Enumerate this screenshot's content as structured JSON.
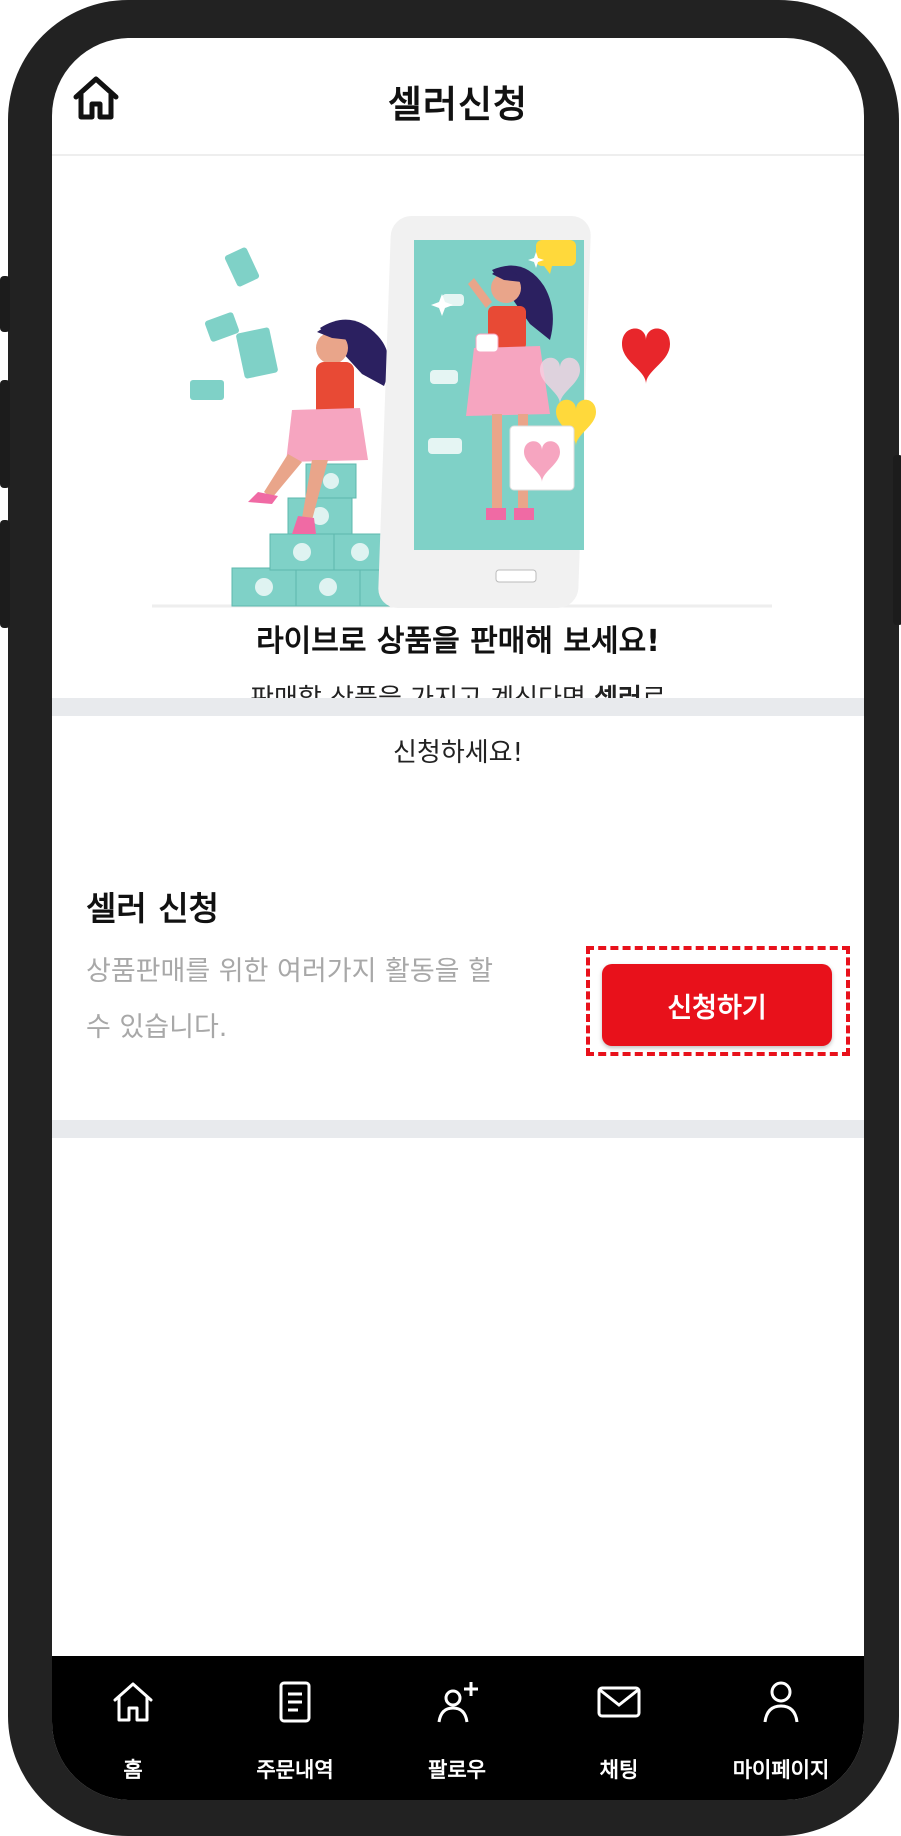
{
  "header": {
    "title": "셀러신청",
    "home_icon": "home-icon"
  },
  "intro": {
    "headline": "라이브로 상품을 판매해 보세요!",
    "line1_prefix": "판매할 상품을 가지고 계신다면 ",
    "line1_bold": "셀러",
    "line1_suffix": "로",
    "line2": "신청하세요!"
  },
  "seller_section": {
    "title": "셀러 신청",
    "description": "상품판매를 위한 여러가지 활동을 할 수 있습니다.",
    "apply_label": "신청하기"
  },
  "tabbar": {
    "items": [
      {
        "label": "홈",
        "icon": "home-icon"
      },
      {
        "label": "주문내역",
        "icon": "document-icon"
      },
      {
        "label": "팔로우",
        "icon": "person-add-icon"
      },
      {
        "label": "채팅",
        "icon": "mail-icon"
      },
      {
        "label": "마이페이지",
        "icon": "person-icon"
      }
    ]
  },
  "colors": {
    "accent": "#e8111b",
    "hero_teal": "#7fd1c7",
    "hero_pink": "#f6a5c0",
    "tabbar_bg": "#000000"
  }
}
